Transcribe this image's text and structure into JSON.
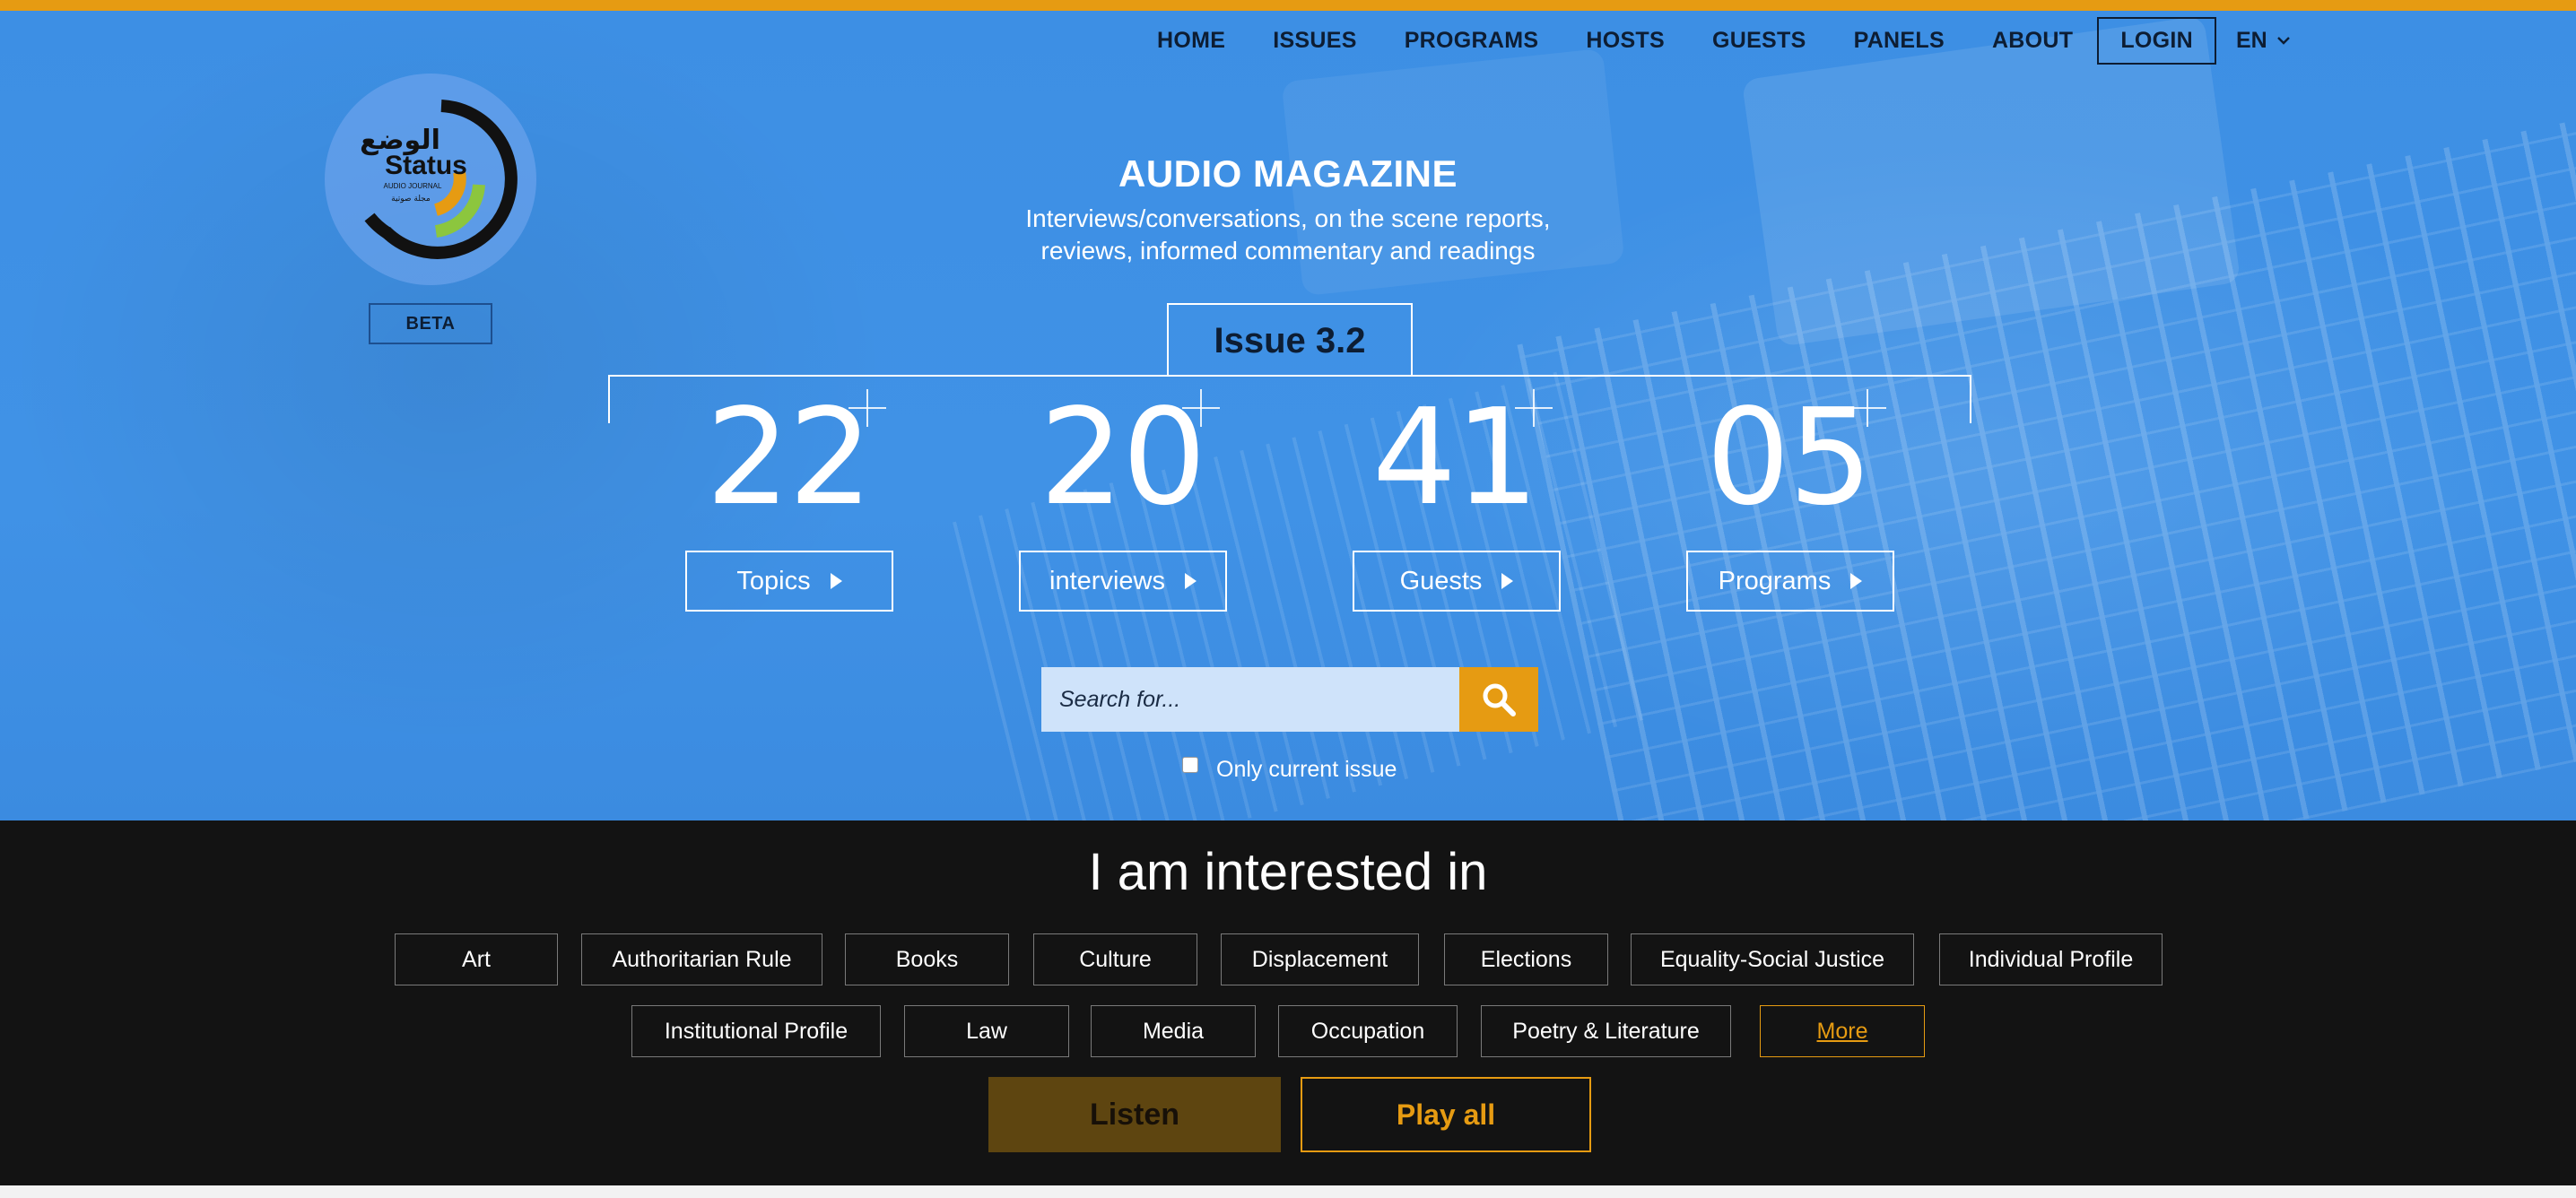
{
  "nav": {
    "items": [
      "HOME",
      "ISSUES",
      "PROGRAMS",
      "HOSTS",
      "GUESTS",
      "PANELS",
      "ABOUT"
    ],
    "login": "LOGIN",
    "language": "EN"
  },
  "logo": {
    "arabic_text": "الوضع",
    "name": "Status",
    "tagline": "AUDIO JOURNAL",
    "arabic_tagline": "مجلة صوتية"
  },
  "beta": "BETA",
  "hero": {
    "title": "AUDIO MAGAZINE",
    "subtitle_line1": "Interviews/conversations, on the scene reports,",
    "subtitle_line2": "reviews, informed commentary and readings",
    "issue": "Issue 3.2"
  },
  "stats": [
    {
      "number": "22",
      "label": "Topics"
    },
    {
      "number": "20",
      "label": "interviews"
    },
    {
      "number": "41",
      "label": "Guests"
    },
    {
      "number": "05",
      "label": "Programs"
    }
  ],
  "search": {
    "placeholder": "Search for...",
    "only_current": "Only current issue",
    "only_current_checked": false
  },
  "interests": {
    "heading": "I am interested in",
    "row1": [
      "Art",
      "Authoritarian Rule",
      "Books",
      "Culture",
      "Displacement",
      "Elections",
      "Equality-Social Justice",
      "Individual Profile"
    ],
    "row2": [
      "Institutional Profile",
      "Law",
      "Media",
      "Occupation",
      "Poetry & Literature"
    ],
    "more": "More",
    "listen": "Listen",
    "play_all": "Play all"
  },
  "colors": {
    "accent": "#e69b12",
    "hero_blue": "#4092e6",
    "dark": "#131313",
    "navy": "#0d1d33"
  }
}
